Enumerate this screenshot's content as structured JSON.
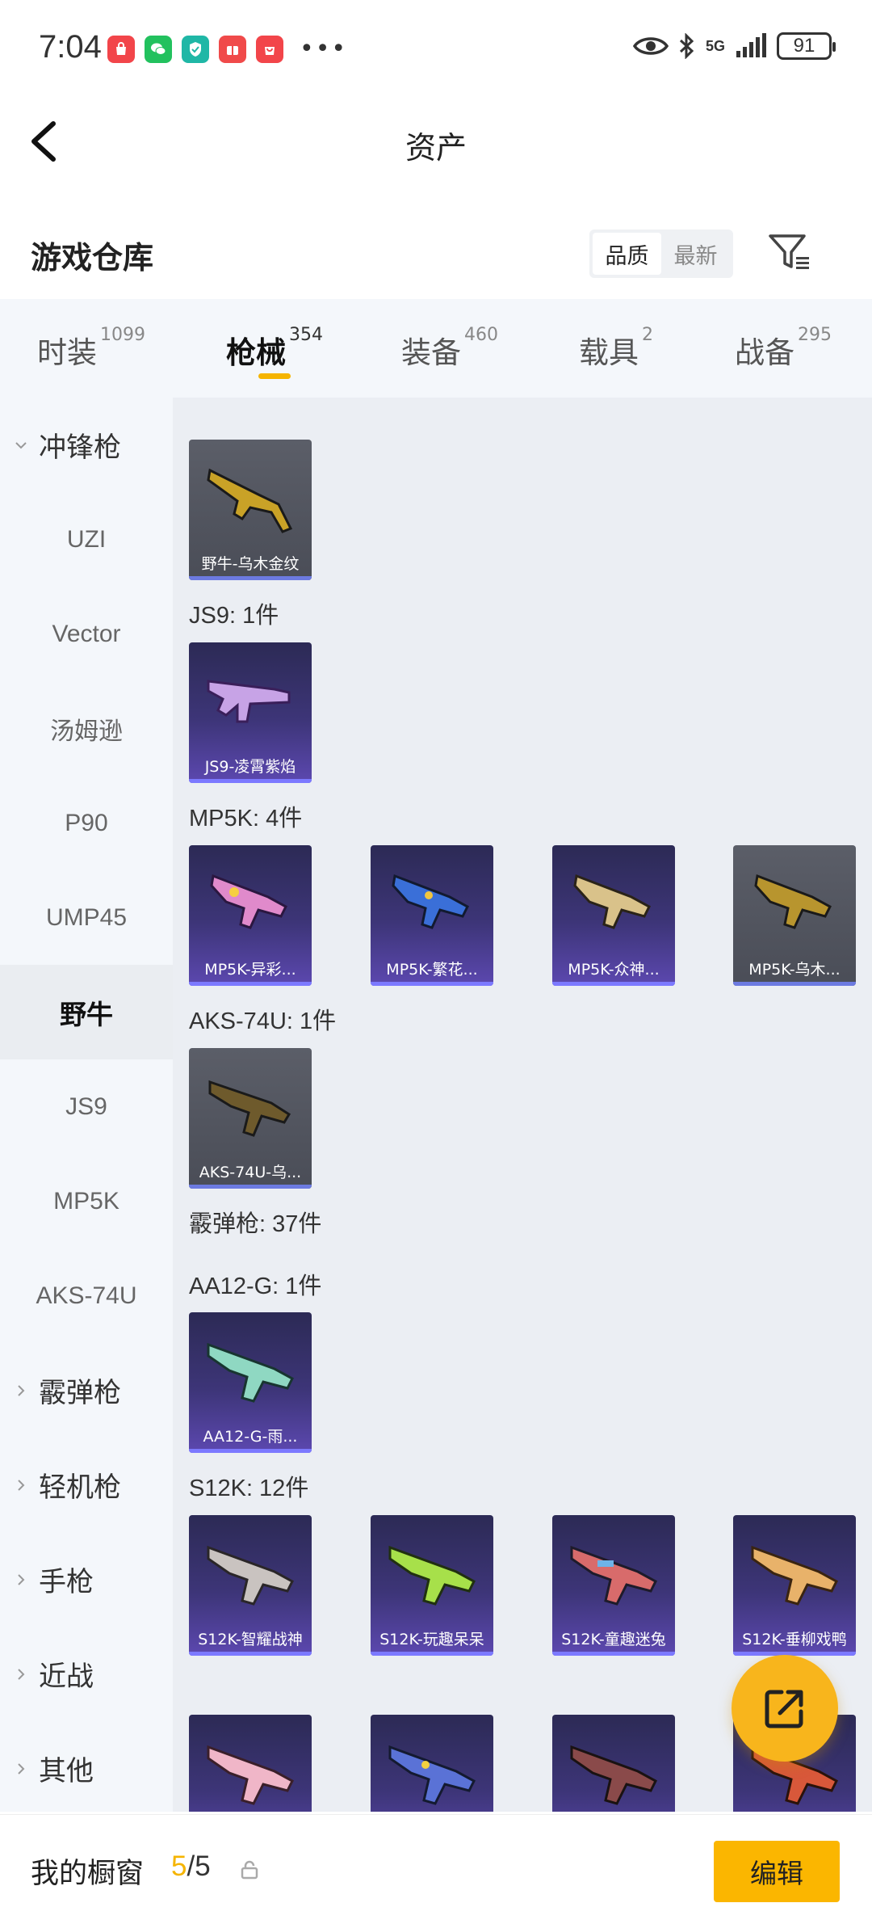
{
  "status_bar": {
    "time": "7:04",
    "network": "5G",
    "battery": "91",
    "icons": [
      "shopping-app-icon",
      "wechat-icon",
      "security-app-icon",
      "gift-app-icon",
      "shopping-bag-icon",
      "eye-icon",
      "bluetooth-icon",
      "signal-icon"
    ]
  },
  "header": {
    "title": "资产"
  },
  "warehouse": {
    "title": "游戏仓库",
    "sort_options": [
      "品质",
      "最新"
    ],
    "sort_selected": "品质"
  },
  "tabs": [
    {
      "label": "时装",
      "count": "1099"
    },
    {
      "label": "枪械",
      "count": "354",
      "active": true
    },
    {
      "label": "装备",
      "count": "460"
    },
    {
      "label": "载具",
      "count": "2"
    },
    {
      "label": "战备",
      "count": "295"
    }
  ],
  "sidebar": [
    {
      "label": "冲锋枪",
      "type": "group",
      "expanded": true
    },
    {
      "label": "UZI"
    },
    {
      "label": "Vector"
    },
    {
      "label": "汤姆逊"
    },
    {
      "label": "P90"
    },
    {
      "label": "UMP45"
    },
    {
      "label": "野牛",
      "active": true
    },
    {
      "label": "JS9"
    },
    {
      "label": "MP5K"
    },
    {
      "label": "AKS-74U"
    },
    {
      "label": "霰弹枪",
      "type": "group"
    },
    {
      "label": "轻机枪",
      "type": "group"
    },
    {
      "label": "手枪",
      "type": "group"
    },
    {
      "label": "近战",
      "type": "group"
    },
    {
      "label": "其他",
      "type": "group"
    }
  ],
  "sections": {
    "bison_cards": [
      {
        "name": "野牛-乌木金纹"
      }
    ],
    "js9_label": "JS9: 1件",
    "js9_cards": [
      {
        "name": "JS9-凌霄紫焰"
      }
    ],
    "mp5k_label": "MP5K: 4件",
    "mp5k_cards": [
      {
        "name": "MP5K-异彩..."
      },
      {
        "name": "MP5K-繁花..."
      },
      {
        "name": "MP5K-众神..."
      },
      {
        "name": "MP5K-乌木..."
      }
    ],
    "aks_label": "AKS-74U: 1件",
    "aks_cards": [
      {
        "name": "AKS-74U-乌..."
      }
    ],
    "shotgun_label": "霰弹枪: 37件",
    "aa12_label": "AA12-G: 1件",
    "aa12_cards": [
      {
        "name": "AA12-G-雨..."
      }
    ],
    "s12k_label": "S12K: 12件",
    "s12k_cards": [
      {
        "name": "S12K-智耀战神"
      },
      {
        "name": "S12K-玩趣呆呆"
      },
      {
        "name": "S12K-童趣迷兔"
      },
      {
        "name": "S12K-垂柳戏鸭"
      }
    ]
  },
  "bottom_bar": {
    "label": "我的橱窗",
    "current": "5",
    "separator": "/",
    "total": "5",
    "edit_label": "编辑"
  },
  "colors": {
    "accent": "#f5b400",
    "card_purple": "#3d3578",
    "card_gray": "#4a4d57",
    "sidebar_bg": "#f4f7fb",
    "content_bg": "#ebeef3"
  }
}
